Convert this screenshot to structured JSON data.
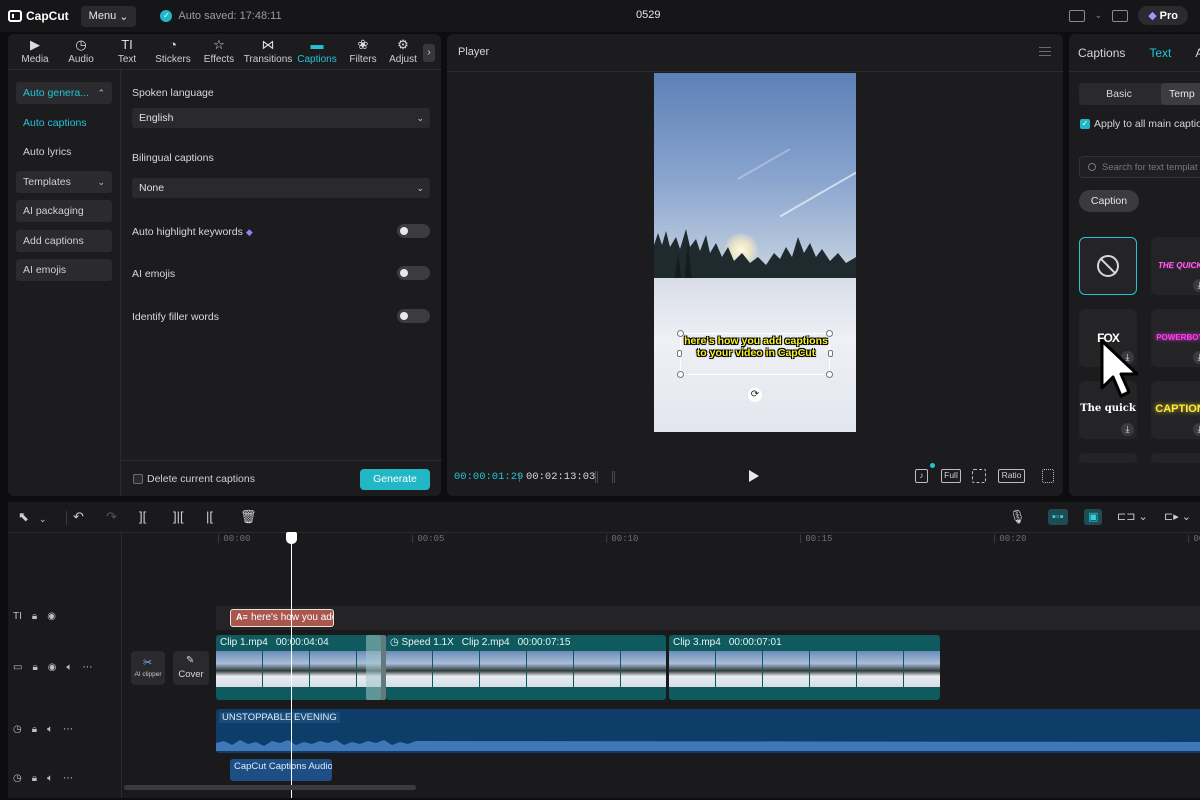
{
  "app": {
    "logo": "CapCut",
    "menu_label": "Menu",
    "autosave": "Auto saved: 17:48:11",
    "project_name": "0529",
    "pro_label": "Pro",
    "accent": "#22c3d6"
  },
  "left_panel": {
    "tabs": [
      {
        "label": "Media",
        "icon": "media-icon"
      },
      {
        "label": "Audio",
        "icon": "audio-icon"
      },
      {
        "label": "Text",
        "icon": "text-icon"
      },
      {
        "label": "Stickers",
        "icon": "stickers-icon"
      },
      {
        "label": "Effects",
        "icon": "effects-icon"
      },
      {
        "label": "Transitions",
        "icon": "transitions-icon"
      },
      {
        "label": "Captions",
        "icon": "captions-icon",
        "active": true
      },
      {
        "label": "Filters",
        "icon": "filters-icon"
      },
      {
        "label": "Adjust",
        "icon": "adjust-icon"
      }
    ],
    "sidenav": [
      {
        "label": "Auto genera..."
      },
      {
        "label": "Auto captions"
      },
      {
        "label": "Auto lyrics"
      },
      {
        "label": "Templates"
      },
      {
        "label": "AI packaging"
      },
      {
        "label": "Add captions"
      },
      {
        "label": "AI emojis"
      }
    ],
    "spoken_language_label": "Spoken language",
    "spoken_language_value": "English",
    "bilingual_label": "Bilingual captions",
    "bilingual_value": "None",
    "toggles": [
      {
        "label": "Auto highlight keywords",
        "on": false
      },
      {
        "label": "AI emojis",
        "on": false
      },
      {
        "label": "Identify filler words",
        "on": false
      }
    ],
    "delete_label": "Delete current captions",
    "generate_label": "Generate"
  },
  "player": {
    "title": "Player",
    "caption_text": "here's how you add captions to your video in CapCut",
    "current_time": "00:00:01:29",
    "total_time": "00:02:13:03",
    "controls": {
      "full": "Full",
      "ratio": "Ratio"
    }
  },
  "right_panel": {
    "tabs": [
      "Captions",
      "Text",
      "A"
    ],
    "segments": [
      "Basic",
      "Temp"
    ],
    "apply_label": "Apply to all main captio",
    "search_placeholder": "Search for text templat",
    "chip": "Caption",
    "tiles": [
      {
        "text": "",
        "style": "none"
      },
      {
        "text": "THE QUICK",
        "color": "#ff66ee"
      },
      {
        "text": "FOX",
        "color": "#ffffff"
      },
      {
        "text": "POWERBOY",
        "color": "#ff3df0"
      },
      {
        "text": "The quick",
        "color": "#ffffff"
      },
      {
        "text": "CAPTION",
        "color": "#ffe93b"
      }
    ]
  },
  "timeline": {
    "ruler": [
      "00:00",
      "00:05",
      "00:10",
      "00:15",
      "00:20",
      "00:2"
    ],
    "caption_clip": "here's how you add",
    "ai_clipper": "AI clipper",
    "cover": "Cover",
    "clips": [
      {
        "name": "Clip 1.mp4",
        "duration": "00:00:04:04"
      },
      {
        "name": "Clip 2.mp4",
        "duration": "00:00:07:15",
        "speed": "Speed 1.1X"
      },
      {
        "name": "Clip 3.mp4",
        "duration": "00:00:07:01"
      }
    ],
    "audio_track": "UNSTOPPABLE EVENING",
    "audio2": "CapCut Captions Audio"
  }
}
